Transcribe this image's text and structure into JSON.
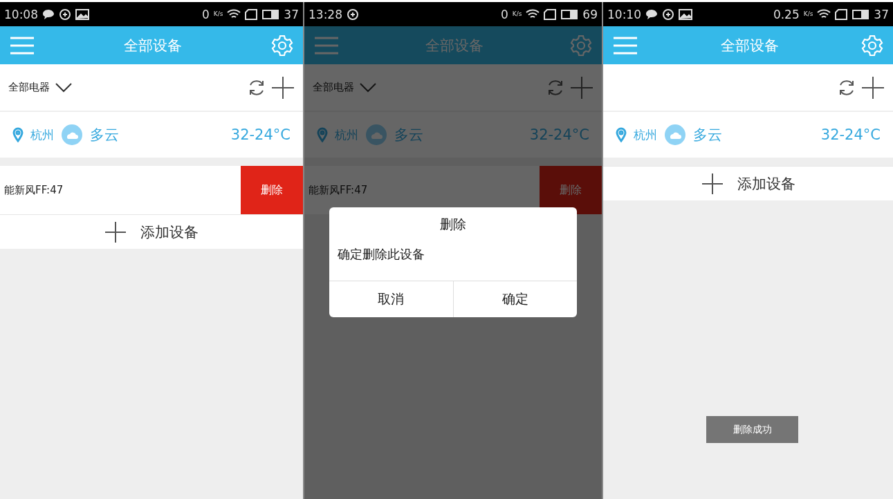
{
  "screens": [
    {
      "status_bar": {
        "time": "10:08",
        "icons": [
          {
            "kind": "chat"
          },
          {
            "kind": "sync"
          },
          {
            "kind": "image"
          }
        ],
        "speed": "0",
        "speed_unit": "K/s",
        "battery": "37"
      },
      "title": "全部设备",
      "filter": "全部电器",
      "weather": {
        "city": "杭州",
        "condition": "多云",
        "temperature": "32-24°C"
      },
      "devices": [
        {
          "name": "能新风FF:47",
          "swiped": true,
          "action": "删除"
        }
      ],
      "add_device": "添加设备"
    },
    {
      "status_bar": {
        "time": "13:28",
        "icons": [
          {
            "kind": "sync"
          }
        ],
        "speed": "0",
        "speed_unit": "K/s",
        "battery": "69"
      },
      "title": "全部设备",
      "filter": "全部电器",
      "weather": {
        "city": "杭州",
        "condition": "多云",
        "temperature": "32-24°C"
      },
      "devices": [
        {
          "name": "能新风FF:47",
          "swiped": true,
          "action": "删除"
        }
      ],
      "dialog": {
        "title": "删除",
        "message": "确定删除此设备",
        "buttons": [
          "取消",
          "确定"
        ]
      }
    },
    {
      "status_bar": {
        "time": "10:10",
        "icons": [
          {
            "kind": "chat"
          },
          {
            "kind": "sync"
          },
          {
            "kind": "image"
          }
        ],
        "speed": "0.25",
        "speed_unit": "K/s",
        "battery": "37"
      },
      "title": "全部设备",
      "weather": {
        "city": "杭州",
        "condition": "多云",
        "temperature": "32-24°C"
      },
      "add_device": "添加设备",
      "toast": "删除成功"
    }
  ]
}
